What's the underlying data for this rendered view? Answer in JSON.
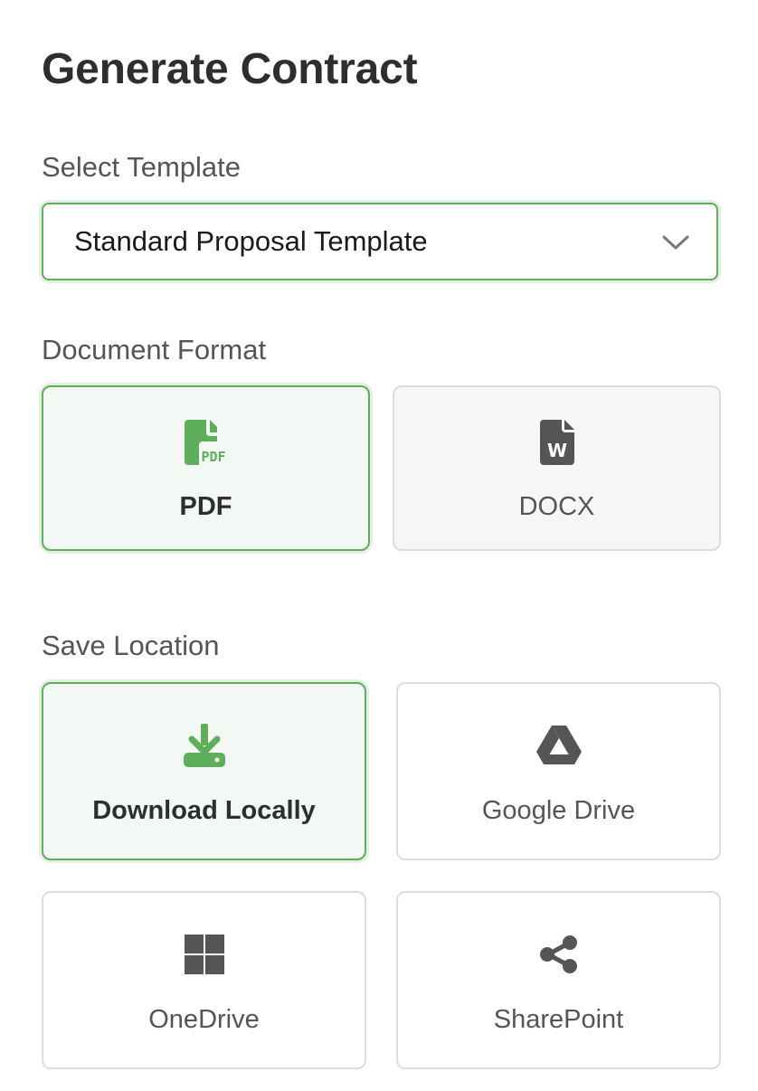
{
  "page": {
    "title": "Generate Contract"
  },
  "template_section": {
    "label": "Select Template",
    "selected": "Standard Proposal Template",
    "dropdown_icon": "chevron-down-icon"
  },
  "format_section": {
    "label": "Document Format",
    "options": [
      {
        "label": "PDF",
        "icon": "pdf-file-icon",
        "selected": true
      },
      {
        "label": "DOCX",
        "icon": "word-file-icon",
        "selected": false
      }
    ]
  },
  "location_section": {
    "label": "Save Location",
    "options": [
      {
        "label": "Download Locally",
        "icon": "download-icon",
        "selected": true
      },
      {
        "label": "Google Drive",
        "icon": "google-drive-icon",
        "selected": false
      },
      {
        "label": "OneDrive",
        "icon": "windows-icon",
        "selected": false
      },
      {
        "label": "SharePoint",
        "icon": "share-icon",
        "selected": false
      }
    ]
  },
  "colors": {
    "accent": "#5fae5c",
    "selected_background": "#f4f8f4",
    "border": "#dcdcdc",
    "icon_gray": "#555555",
    "title": "#2e2e2e"
  }
}
